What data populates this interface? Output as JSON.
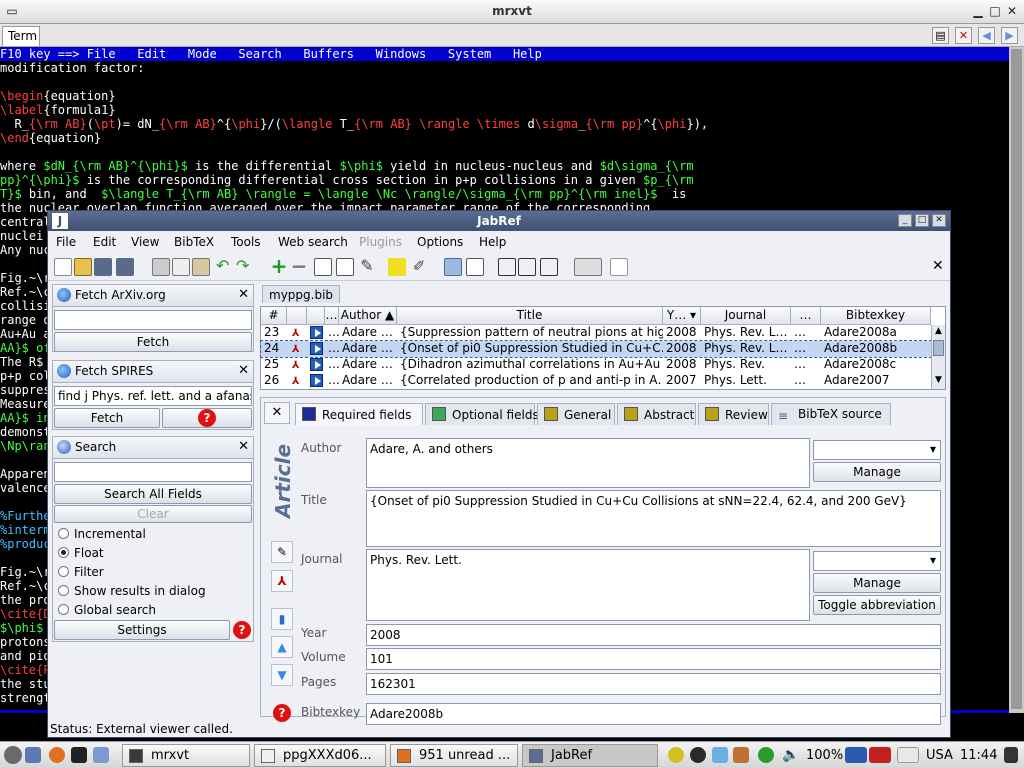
{
  "terminal": {
    "window_title": "mrxvt",
    "tab_label": "Term",
    "menubar": "F10 key ==> File   Edit   Mode   Search   Buffers   Windows   System   Help",
    "lines": [
      [
        [
          "modification factor:",
          "#ffffff"
        ]
      ],
      [
        [
          "",
          ""
        ]
      ],
      [
        [
          "\\begin",
          "#ff4040"
        ],
        [
          "{equation}",
          "#ffffff"
        ]
      ],
      [
        [
          "\\label",
          "#ff4040"
        ],
        [
          "{formula1}",
          "#ffffff"
        ]
      ],
      [
        [
          "  R_",
          "#ffffff"
        ],
        [
          "{\\rm AB}",
          "#ff4040"
        ],
        [
          "(",
          "#ffffff"
        ],
        [
          "\\pt",
          "#ff4040"
        ],
        [
          ")= dN_",
          "#ffffff"
        ],
        [
          "{\\rm AB}",
          "#ff4040"
        ],
        [
          "^{",
          "#ffffff"
        ],
        [
          "\\phi",
          "#ff4040"
        ],
        [
          "}/(",
          "#ffffff"
        ],
        [
          "\\langle",
          "#ff4040"
        ],
        [
          " T_",
          "#ffffff"
        ],
        [
          "{\\rm AB}",
          "#ff4040"
        ],
        [
          " ",
          "#ffffff"
        ],
        [
          "\\rangle \\times",
          "#ff4040"
        ],
        [
          " d",
          "#ffffff"
        ],
        [
          "\\sigma",
          "#ff4040"
        ],
        [
          "_",
          "#ffffff"
        ],
        [
          "{\\rm pp}",
          "#ff4040"
        ],
        [
          "^{",
          "#ffffff"
        ],
        [
          "\\phi",
          "#ff4040"
        ],
        [
          "}),",
          "#ffffff"
        ]
      ],
      [
        [
          "\\end",
          "#ff4040"
        ],
        [
          "{equation}",
          "#ffffff"
        ]
      ],
      [
        [
          "",
          ""
        ]
      ],
      [
        [
          "where ",
          "#ffffff"
        ],
        [
          "$dN_{\\rm AB}^{\\phi}$",
          "#40ff40"
        ],
        [
          " is the differential ",
          "#ffffff"
        ],
        [
          "$\\phi$",
          "#40ff40"
        ],
        [
          " yield in nucleus-nucleus and ",
          "#ffffff"
        ],
        [
          "$d\\sigma_{\\rm",
          "#40ff40"
        ]
      ],
      [
        [
          "pp}^{\\phi}$",
          "#40ff40"
        ],
        [
          " is the corresponding differential cross section in p+p collisions in a given ",
          "#ffffff"
        ],
        [
          "$p_{\\rm",
          "#40ff40"
        ]
      ],
      [
        [
          "T}$",
          "#40ff40"
        ],
        [
          " bin, and  ",
          "#ffffff"
        ],
        [
          "$\\langle T_{\\rm AB} \\rangle = \\langle \\Nc \\rangle/\\sigma_{\\rm pp}^{\\rm inel}$",
          "#40ff40"
        ],
        [
          "  is",
          "#ffffff"
        ]
      ],
      [
        [
          "the nuclear overlap function averaged over the impact parameter range of the corresponding",
          "#ffffff"
        ]
      ],
      [
        [
          "centrality",
          "#ffffff"
        ]
      ],
      [
        [
          "nuclei",
          "#ffffff"
        ]
      ],
      [
        [
          "Any nuc",
          "#ffffff"
        ]
      ],
      [
        [
          "",
          ""
        ]
      ],
      [
        [
          "Fig.~\\r",
          "#ffffff"
        ]
      ],
      [
        [
          "Ref.~\\c",
          "#ffffff"
        ]
      ],
      [
        [
          "collisi",
          "#ffffff"
        ]
      ],
      [
        [
          "range o",
          "#ffffff"
        ]
      ],
      [
        [
          "Au+Au a",
          "#ffffff"
        ]
      ],
      [
        [
          "AA}$ of",
          "#40ff40"
        ]
      ],
      [
        [
          "The R$",
          "#ffffff"
        ]
      ],
      [
        [
          "p+p col",
          "#ffffff"
        ]
      ],
      [
        [
          "suppres",
          "#ffffff"
        ]
      ],
      [
        [
          "Measure",
          "#ffffff"
        ]
      ],
      [
        [
          "AA}$ in",
          "#40ff40"
        ]
      ],
      [
        [
          "demonst",
          "#ffffff"
        ]
      ],
      [
        [
          "\\Np\\ran",
          "#40ff40"
        ]
      ],
      [
        [
          "",
          ""
        ]
      ],
      [
        [
          "Apparen",
          "#ffffff"
        ]
      ],
      [
        [
          "valence",
          "#ffffff"
        ]
      ],
      [
        [
          "",
          ""
        ]
      ],
      [
        [
          "%Furthe",
          "#40c0ff"
        ]
      ],
      [
        [
          "%interm",
          "#40c0ff"
        ]
      ],
      [
        [
          "%produc",
          "#40c0ff"
        ]
      ],
      [
        [
          "",
          ""
        ]
      ],
      [
        [
          "Fig.~\\r",
          "#ffffff"
        ]
      ],
      [
        [
          "Ref.~\\c",
          "#ffffff"
        ]
      ],
      [
        [
          "the pro",
          "#ffffff"
        ]
      ],
      [
        [
          "\\cite{D",
          "#ff4040"
        ]
      ],
      [
        [
          "$\\phi$ ",
          "#40ff40"
        ]
      ],
      [
        [
          "protons",
          "#ffffff"
        ]
      ],
      [
        [
          "and pio",
          "#ffffff"
        ]
      ],
      [
        [
          "\\cite{P",
          "#ff4040"
        ]
      ],
      [
        [
          "the stu",
          "#ffffff"
        ]
      ],
      [
        [
          "strengt",
          "#ffffff"
        ]
      ]
    ]
  },
  "jabref": {
    "title": "JabRef",
    "menu": [
      "File",
      "Edit",
      "View",
      "BibTeX",
      "Tools",
      "Web search",
      "Plugins",
      "Options",
      "Help"
    ],
    "fetch_arxiv": {
      "title": "Fetch ArXiv.org",
      "input": "",
      "button": "Fetch"
    },
    "fetch_spires": {
      "title": "Fetch SPIRES",
      "input": "find j Phys. ref. lett. and a afanas",
      "button": "Fetch"
    },
    "search": {
      "title": "Search",
      "input": "",
      "search_all": "Search All Fields",
      "clear": "Clear",
      "options": [
        {
          "label": "Incremental",
          "checked": false
        },
        {
          "label": "Float",
          "checked": true
        },
        {
          "label": "Filter",
          "checked": false
        },
        {
          "label": "Show results in dialog",
          "checked": false
        },
        {
          "label": "Global search",
          "checked": false
        }
      ],
      "settings": "Settings"
    },
    "database_tab": "myppg.bib",
    "table": {
      "headers": [
        "#",
        "",
        "",
        "…",
        "Author ▲",
        "Title",
        "Y… ▾",
        "Journal",
        "…",
        "Bibtexkey"
      ],
      "rows": [
        {
          "num": "23",
          "dots": "…",
          "author": "Adare …",
          "title": "{Suppression pattern of neutral pions at hig…",
          "year": "2008",
          "journal": "Phys. Rev. L…",
          "dots2": "…",
          "key": "Adare2008a",
          "selected": false
        },
        {
          "num": "24",
          "dots": "…",
          "author": "Adare …",
          "title": "{Onset of pi0 Suppression Studied in Cu+C…",
          "year": "2008",
          "journal": "Phys. Rev. L…",
          "dots2": "…",
          "key": "Adare2008b",
          "selected": true
        },
        {
          "num": "25",
          "dots": "…",
          "author": "Adare …",
          "title": "{Dihadron azimuthal correlations in Au+Au …",
          "year": "2008",
          "journal": "Phys. Rev.",
          "dots2": "…",
          "key": "Adare2008c",
          "selected": false
        },
        {
          "num": "26",
          "dots": "…",
          "author": "Adare …",
          "title": "{Correlated production of p and anti-p in A…",
          "year": "2007",
          "journal": "Phys. Lett.",
          "dots2": "…",
          "key": "Adare2007",
          "selected": false
        }
      ]
    },
    "editor": {
      "tabs": [
        {
          "label": "Required fields",
          "color": "#1c2a9a"
        },
        {
          "label": "Optional fields",
          "color": "#3ea85a"
        },
        {
          "label": "General",
          "color": "#b8a21a"
        },
        {
          "label": "Abstract",
          "color": "#b8a21a"
        },
        {
          "label": "Review",
          "color": "#b8a21a"
        },
        {
          "label": "BibTeX source",
          "color": ""
        }
      ],
      "entry_type": "Article",
      "fields": {
        "author_label": "Author",
        "author": "Adare, A. and others",
        "title_label": "Title",
        "title": "{Onset of pi0 Suppression Studied in Cu+Cu Collisions at sNN=22.4, 62.4, and 200 GeV}",
        "journal_label": "Journal",
        "journal": "Phys. Rev. Lett.",
        "year_label": "Year",
        "year": "2008",
        "volume_label": "Volume",
        "volume": "101",
        "pages_label": "Pages",
        "pages": "162301",
        "bibtexkey_label": "Bibtexkey",
        "bibtexkey": "Adare2008b"
      },
      "manage": "Manage",
      "toggle_abbreviation": "Toggle abbreviation"
    },
    "status": "Status: External viewer called."
  },
  "taskbar": {
    "tasks": [
      {
        "label": "mrxvt",
        "active": false
      },
      {
        "label": "ppgXXXd06...",
        "active": false
      },
      {
        "label": "951 unread ...",
        "active": false
      },
      {
        "label": "JabRef",
        "active": true
      }
    ],
    "zoom": "100%",
    "locale": "USA",
    "clock": "11:44"
  }
}
